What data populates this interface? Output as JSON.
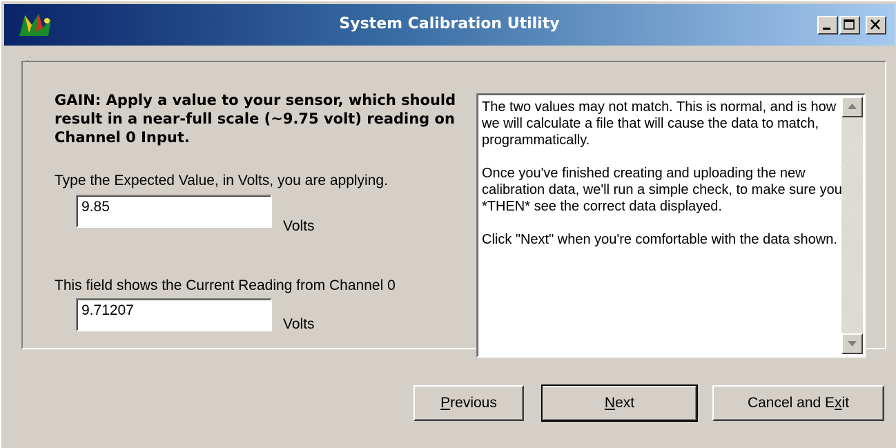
{
  "window": {
    "title": "System Calibration Utility",
    "controls": {
      "minimize": "minimize",
      "maximize": "maximize",
      "close": "close"
    }
  },
  "group": {
    "marker": "·˙"
  },
  "left": {
    "heading": "GAIN: Apply a value to your sensor, which should result in a near-full scale (~9.75 volt) reading on Channel 0 Input.",
    "expected_label": "Type the Expected Value, in Volts, you are applying.",
    "expected_value": "9.85",
    "expected_unit": "Volts",
    "current_label": "This field shows the Current Reading from Channel 0",
    "current_value": "9.71207",
    "current_unit": "Volts"
  },
  "memo": {
    "paragraphs": [
      "The two values may not match.  This is normal, and is how we will calculate a file that will cause the data to match, programmatically.",
      "Once you've finished creating and uploading the new calibration data, we'll run a simple check, to make sure you *THEN* see the correct data displayed.",
      "Click \"Next\" when you're comfortable with the data shown."
    ]
  },
  "buttons": {
    "previous": {
      "before": "",
      "accel": "P",
      "after": "revious"
    },
    "next": {
      "before": "",
      "accel": "N",
      "after": "ext"
    },
    "cancel": {
      "before": "Cancel and E",
      "accel": "x",
      "after": "it"
    }
  },
  "icons": {
    "app": "app-logo-icon",
    "scroll_up": "scroll-up-icon",
    "scroll_down": "scroll-down-icon"
  }
}
